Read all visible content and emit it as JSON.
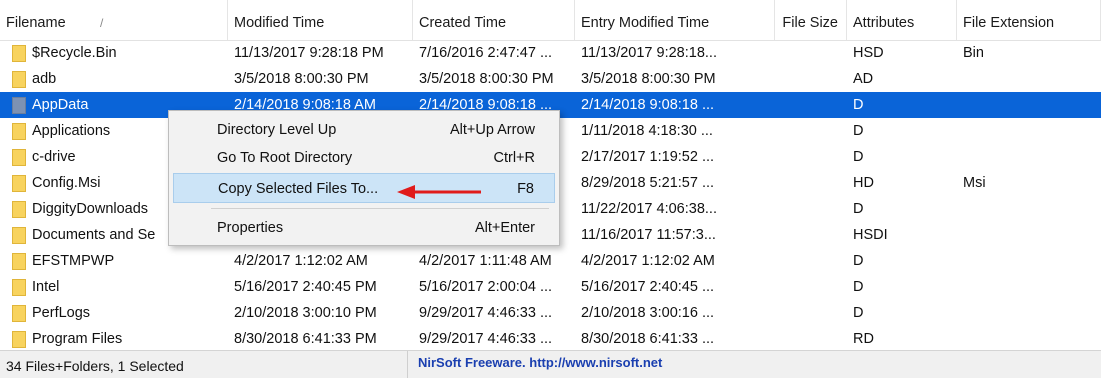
{
  "columns": [
    {
      "label": "Filename"
    },
    {
      "label": "Modified Time"
    },
    {
      "label": "Created Time"
    },
    {
      "label": "Entry Modified Time"
    },
    {
      "label": "File Size"
    },
    {
      "label": "Attributes"
    },
    {
      "label": "File Extension"
    }
  ],
  "sort_indicator": "/",
  "rows": [
    {
      "name": "$Recycle.Bin",
      "modified": "11/13/2017 9:28:18 PM",
      "created": "7/16/2016 2:47:47 ...",
      "entry_modified": "11/13/2017 9:28:18...",
      "size": "",
      "attributes": "HSD",
      "extension": "Bin"
    },
    {
      "name": "adb",
      "modified": "3/5/2018 8:00:30 PM",
      "created": "3/5/2018 8:00:30 PM",
      "entry_modified": "3/5/2018 8:00:30 PM",
      "size": "",
      "attributes": "AD",
      "extension": ""
    },
    {
      "name": "AppData",
      "modified": "2/14/2018 9:08:18 AM",
      "created": "2/14/2018 9:08:18 ...",
      "entry_modified": "2/14/2018 9:08:18 ...",
      "size": "",
      "attributes": "D",
      "extension": "",
      "selected": true
    },
    {
      "name": "Applications",
      "modified": "",
      "created": "",
      "entry_modified": "1/11/2018 4:18:30 ...",
      "size": "",
      "attributes": "D",
      "extension": ""
    },
    {
      "name": "c-drive",
      "modified": "",
      "created": "",
      "entry_modified": "2/17/2017 1:19:52 ...",
      "size": "",
      "attributes": "D",
      "extension": ""
    },
    {
      "name": "Config.Msi",
      "modified": "",
      "created": "",
      "entry_modified": "8/29/2018 5:21:57 ...",
      "size": "",
      "attributes": "HD",
      "extension": "Msi"
    },
    {
      "name": "DiggityDownloads",
      "modified": "",
      "created": "",
      "entry_modified": "11/22/2017 4:06:38...",
      "size": "",
      "attributes": "D",
      "extension": ""
    },
    {
      "name": "Documents and Se",
      "modified": "",
      "created": "",
      "entry_modified": "11/16/2017 11:57:3...",
      "size": "",
      "attributes": "HSDI",
      "extension": ""
    },
    {
      "name": "EFSTMPWP",
      "modified": "4/2/2017 1:12:02 AM",
      "created": "4/2/2017 1:11:48 AM",
      "entry_modified": "4/2/2017 1:12:02 AM",
      "size": "",
      "attributes": "D",
      "extension": ""
    },
    {
      "name": "Intel",
      "modified": "5/16/2017 2:40:45 PM",
      "created": "5/16/2017 2:00:04 ...",
      "entry_modified": "5/16/2017 2:40:45 ...",
      "size": "",
      "attributes": "D",
      "extension": ""
    },
    {
      "name": "PerfLogs",
      "modified": "2/10/2018 3:00:10 PM",
      "created": "9/29/2017 4:46:33 ...",
      "entry_modified": "2/10/2018 3:00:16 ...",
      "size": "",
      "attributes": "D",
      "extension": ""
    },
    {
      "name": "Program Files",
      "modified": "8/30/2018 6:41:33 PM",
      "created": "9/29/2017 4:46:33 ...",
      "entry_modified": "8/30/2018 6:41:33 ...",
      "size": "",
      "attributes": "RD",
      "extension": ""
    }
  ],
  "context_menu": {
    "items": [
      {
        "label": "Directory Level Up",
        "shortcut": "Alt+Up Arrow"
      },
      {
        "label": "Go To Root Directory",
        "shortcut": "Ctrl+R"
      },
      {
        "label": "Copy Selected Files To...",
        "shortcut": "F8",
        "highlighted": true
      },
      {
        "label": "Properties",
        "shortcut": "Alt+Enter"
      }
    ]
  },
  "statusbar": {
    "count_text": "34 Files+Folders, 1 Selected",
    "credit_text": "NirSoft Freeware.  http://www.nirsoft.net"
  },
  "colors": {
    "selection": "#0a64d8",
    "menu_highlight": "#cce4f7",
    "annotation_arrow": "#e01b1b",
    "credit_link": "#1a3fb0"
  }
}
